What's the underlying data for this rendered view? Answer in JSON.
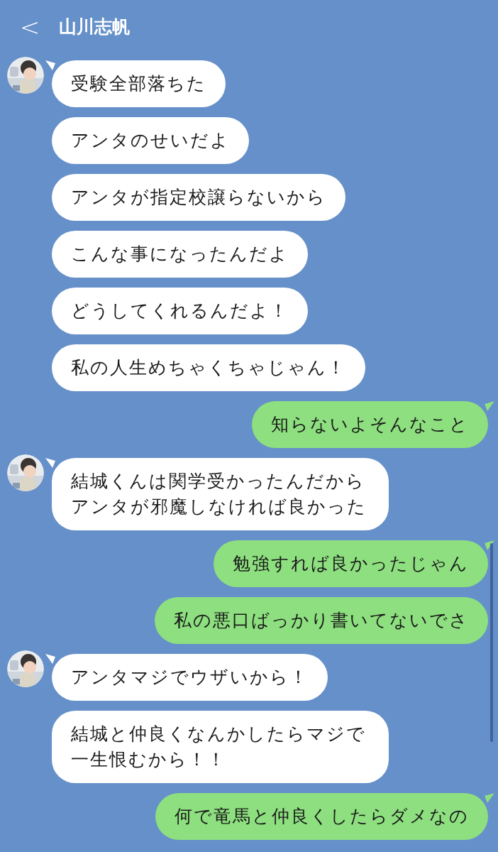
{
  "header": {
    "back": "<",
    "title": "山川志帆"
  },
  "messages": [
    {
      "kind": "received",
      "avatar": true,
      "tail": true,
      "text": "受験全部落ちた"
    },
    {
      "kind": "received",
      "avatar": false,
      "tail": false,
      "text": "アンタのせいだよ"
    },
    {
      "kind": "received",
      "avatar": false,
      "tail": false,
      "text": "アンタが指定校譲らないから"
    },
    {
      "kind": "received",
      "avatar": false,
      "tail": false,
      "text": "こんな事になったんだよ"
    },
    {
      "kind": "received",
      "avatar": false,
      "tail": false,
      "text": "どうしてくれるんだよ！"
    },
    {
      "kind": "received",
      "avatar": false,
      "tail": false,
      "text": "私の人生めちゃくちゃじゃん！"
    },
    {
      "kind": "sent",
      "avatar": false,
      "tail": true,
      "text": "知らないよそんなこと"
    },
    {
      "kind": "received",
      "avatar": true,
      "tail": true,
      "text": "結城くんは関学受かったんだからアンタが邪魔しなければ良かった"
    },
    {
      "kind": "sent",
      "avatar": false,
      "tail": true,
      "text": "勉強すれば良かったじゃん"
    },
    {
      "kind": "sent",
      "avatar": false,
      "tail": false,
      "text": "私の悪口ばっかり書いてないでさ"
    },
    {
      "kind": "received",
      "avatar": true,
      "tail": true,
      "text": "アンタマジでウザいから！"
    },
    {
      "kind": "received",
      "avatar": false,
      "tail": false,
      "text": "結城と仲良くなんかしたらマジで一生恨むから！！"
    },
    {
      "kind": "sent",
      "avatar": false,
      "tail": true,
      "text": "何で竜馬と仲良くしたらダメなの"
    }
  ]
}
